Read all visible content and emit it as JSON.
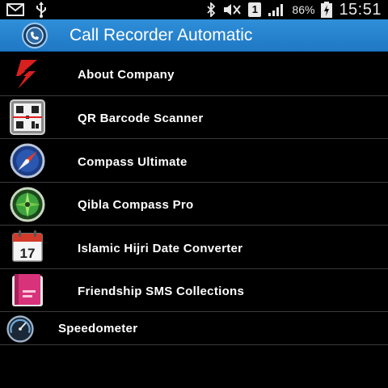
{
  "status_bar": {
    "battery_percent": "86%",
    "time": "15:51",
    "sim_label": "1",
    "icons": [
      "email-icon",
      "usb-icon",
      "bluetooth-icon",
      "mute-icon",
      "signal-icon",
      "battery-icon"
    ]
  },
  "action_bar": {
    "title": "Call Recorder Automatic",
    "icon": "call-recorder-app-icon",
    "color": "#2783cf"
  },
  "apps": [
    {
      "label": "About Company",
      "icon": "company-logo-icon"
    },
    {
      "label": "QR Barcode Scanner",
      "icon": "qr-scanner-icon"
    },
    {
      "label": "Compass Ultimate",
      "icon": "compass-icon"
    },
    {
      "label": "Qibla Compass Pro",
      "icon": "qibla-compass-icon"
    },
    {
      "label": "Islamic Hijri Date Converter",
      "icon": "calendar-icon",
      "icon_text": "17"
    },
    {
      "label": "Friendship SMS Collections",
      "icon": "sms-book-icon"
    },
    {
      "label": "Speedometer",
      "icon": "speedometer-icon"
    }
  ]
}
